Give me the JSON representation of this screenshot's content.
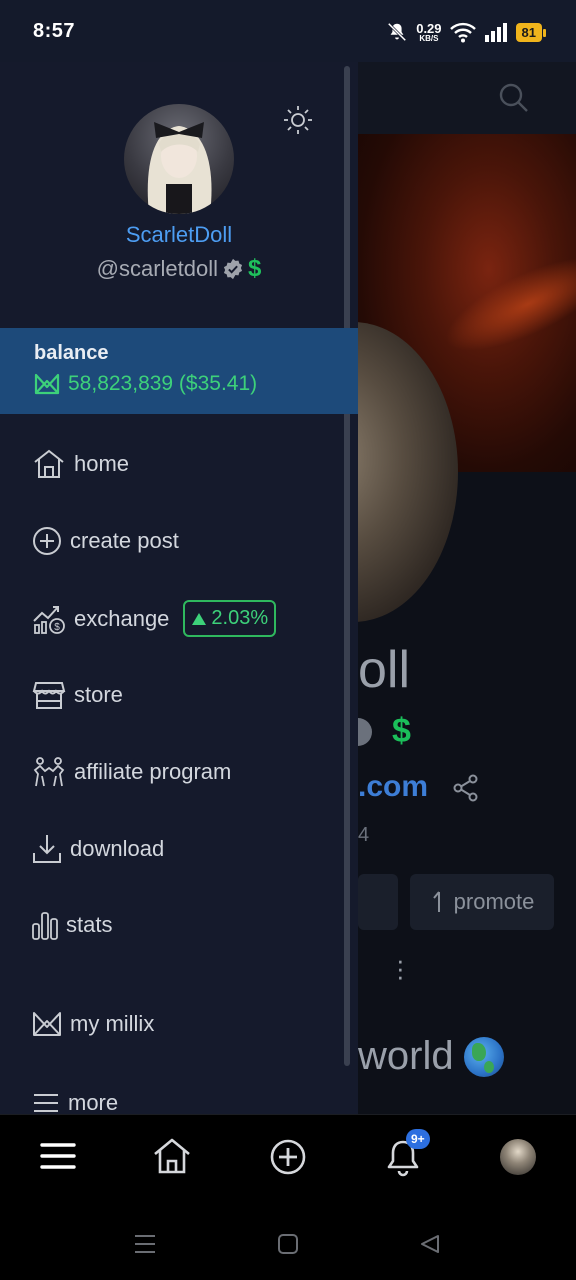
{
  "status_bar": {
    "time": "8:57",
    "net_speed_value": "0.29",
    "net_speed_unit": "KB/S",
    "battery": "81",
    "icons": [
      "bell-muted-icon",
      "wifi-icon",
      "signal-icon",
      "battery-icon"
    ]
  },
  "drawer": {
    "display_name": "ScarletDoll",
    "handle": "@scarletdoll",
    "handle_badges": [
      "verified-icon",
      "dollar-icon"
    ],
    "dollar_symbol": "$",
    "balance": {
      "label": "balance",
      "amount": "58,823,839 ($35.41)"
    },
    "menu": [
      {
        "label": "home",
        "icon": "home-icon"
      },
      {
        "label": "create post",
        "icon": "plus-circle-icon"
      },
      {
        "label": "exchange",
        "icon": "exchange-chart-icon",
        "badge": "2.03%"
      },
      {
        "label": "store",
        "icon": "store-icon"
      },
      {
        "label": "affiliate program",
        "icon": "affiliate-icon"
      },
      {
        "label": "download",
        "icon": "download-icon"
      },
      {
        "label": "stats",
        "icon": "stats-icon"
      },
      {
        "label": "my millix",
        "icon": "millix-icon"
      },
      {
        "label": "more",
        "icon": "menu-icon"
      }
    ]
  },
  "background_page": {
    "name_fragment": "oll",
    "dollar_symbol": "$",
    "link_fragment": ".com",
    "count_fragment": "4",
    "promote_label": "promote",
    "world_fragment": "world"
  },
  "bottom_nav": {
    "items": [
      "menu-icon",
      "home-icon",
      "create-icon",
      "notifications-icon",
      "profile-avatar"
    ],
    "notification_badge": "9+"
  },
  "colors": {
    "drawer_bg": "#151a2c",
    "balance_bg": "#1d4a7a",
    "accent_blue": "#4d9df2",
    "accent_green": "#3dd17a",
    "battery": "#f0b41c"
  }
}
